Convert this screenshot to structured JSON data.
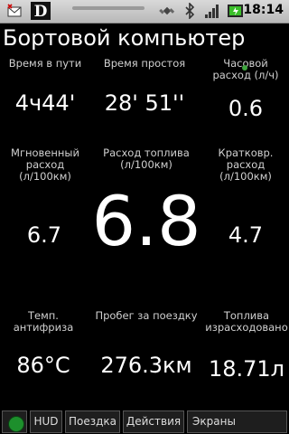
{
  "status_bar": {
    "time": "18:14",
    "icons": [
      "mail-notification-icon",
      "app-logo-icon",
      "gps-icon",
      "bluetooth-icon",
      "signal-icon",
      "battery-icon"
    ]
  },
  "title": "Бортовой компьютер",
  "metrics": {
    "travel_time": {
      "label": "Время в пути",
      "value": "4ч44'"
    },
    "idle_time": {
      "label": "Время простоя",
      "value": "28' 51''"
    },
    "hourly_consumption": {
      "label": "Часовой расход (л/ч)",
      "value": "0.6"
    },
    "instant_consumption": {
      "label": "Мгновенный расход (л/100км)",
      "value": "6.7"
    },
    "fuel_consumption": {
      "label": "Расход топлива (л/100км)",
      "value": "6.8"
    },
    "short_term_consumption": {
      "label": "Кратковр. расход (л/100км)",
      "value": "4.7"
    },
    "coolant_temp": {
      "label": "Темп. антифриза",
      "value": "86°C"
    },
    "trip_distance": {
      "label": "Пробег за поездку",
      "value": "276.3км"
    },
    "fuel_used": {
      "label": "Топлива израсходовано",
      "value": "18.71л"
    }
  },
  "toolbar": {
    "hud": "HUD",
    "trip": "Поездка",
    "actions": "Действия",
    "screens": "Экраны"
  },
  "colors": {
    "background": "#000000",
    "status_led": "#1d8f2c",
    "status_bar": "#cfcfcf"
  }
}
